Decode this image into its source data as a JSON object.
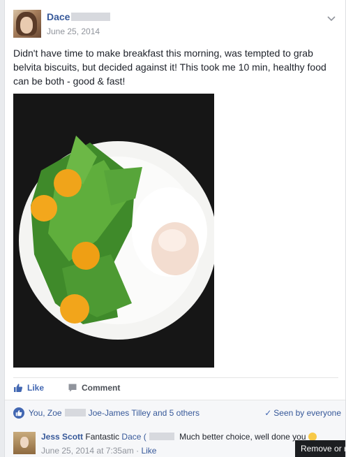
{
  "post": {
    "author": "Dace",
    "date": "June 25, 2014",
    "text": "Didn't have time to make breakfast this morning, was tempted to grab belvita biscuits, but decided against it! This took me 10 min, healthy food can be both - good & fast!"
  },
  "actions": {
    "like_label": "Like",
    "comment_label": "Comment"
  },
  "likes": {
    "prefix": "You, Zoe",
    "suffix": "Joe-James Tilley and 5 others",
    "seen": "Seen by everyone"
  },
  "comment": {
    "author": "Jess Scott",
    "text_before": "Fantastic",
    "tagged": "Dace (",
    "text_after": "Much better choice, well done you",
    "time": "June 25, 2014 at 7:35am",
    "separator": "·",
    "like_label": "Like"
  },
  "tooltip": {
    "label": "Remove or re"
  },
  "icons": {
    "menu": "chevron-down-icon",
    "like": "thumbs-up-icon",
    "comment": "speech-bubble-icon",
    "seen": "checkmark-icon",
    "emoji": "smiley-emoji-icon"
  },
  "colors": {
    "link": "#365899",
    "accent": "#4267b2",
    "meta": "#90949c"
  }
}
